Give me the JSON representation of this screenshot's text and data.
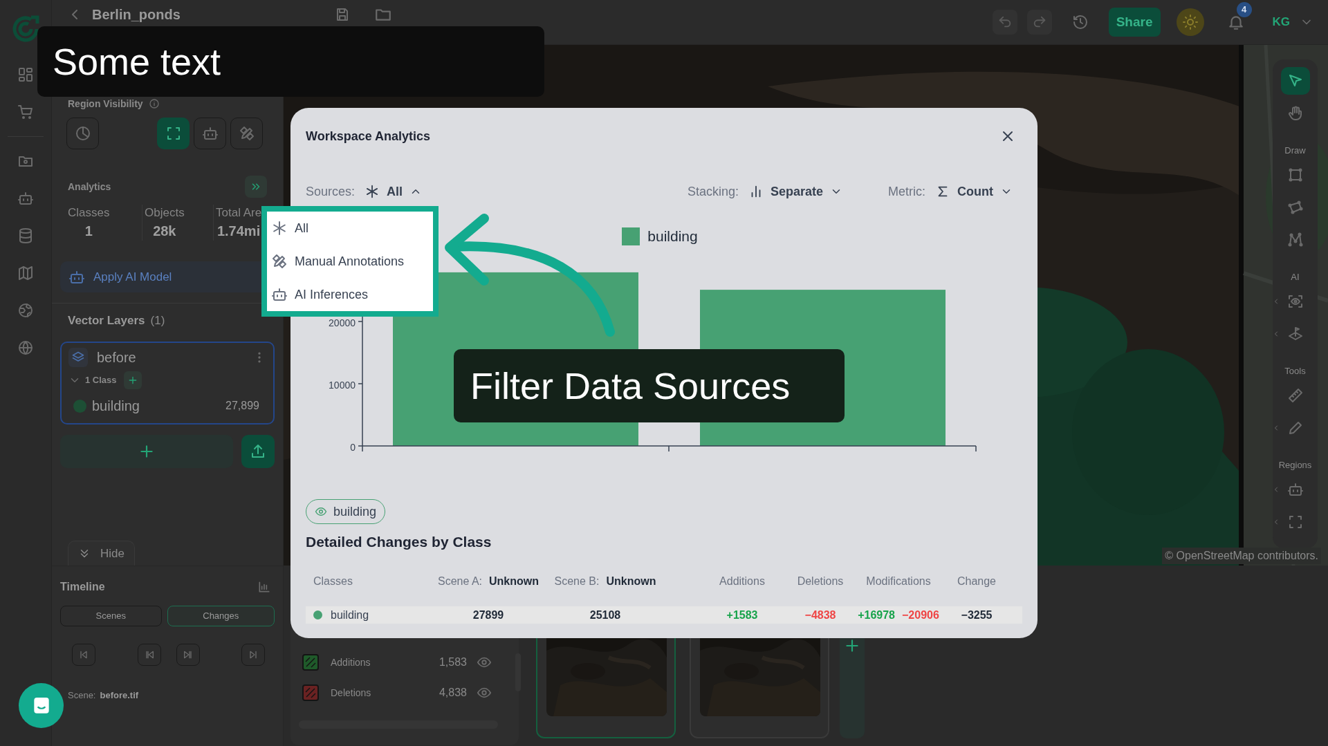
{
  "top_bar": {
    "project_title": "Berlin_ponds",
    "share_button": "Share",
    "notification_count": "4",
    "user_initials": "KG"
  },
  "caption": "Some text",
  "left_panel": {
    "region_visibility_label": "Region Visibility",
    "region_buttons": [
      {
        "selected": false
      },
      {
        "selected": true
      },
      {
        "selected": false
      },
      {
        "selected": false
      }
    ],
    "analytics_title": "Analytics",
    "stats": [
      {
        "label": "Classes",
        "value": "1"
      },
      {
        "label": "Objects",
        "value": "28k"
      },
      {
        "label": "Total Are",
        "value": "1.74mi"
      }
    ],
    "apply_ai_button": "Apply AI Model",
    "vector_layers_title": "Vector Layers",
    "vector_layers_count": "(1)",
    "layers": [
      {
        "name": "before",
        "class_count": "1 Class",
        "expanded": true,
        "classes": [
          {
            "name": "building",
            "count": "27,899",
            "color": "#1d4f35"
          }
        ]
      }
    ],
    "hide_button": "Hide"
  },
  "timeline": {
    "title": "Timeline",
    "tabs": [
      {
        "label": "Scenes",
        "selected": false
      },
      {
        "label": "Changes",
        "selected": true
      }
    ],
    "scene_label": "Scene:",
    "scene_value": "before.tif"
  },
  "change_layers": [
    {
      "label": "Additions",
      "count": "1,583",
      "color": "#1f5a2a"
    },
    {
      "label": "Deletions",
      "count": "4,838",
      "color": "#6a2222"
    }
  ],
  "thumbnails": [
    {
      "selected": true
    },
    {
      "selected": false
    }
  ],
  "map": {
    "attribution": "© OpenStreetMap contributors."
  },
  "map_tools": [
    {
      "kind": "select",
      "selected": true,
      "menu": false
    },
    {
      "kind": "pan",
      "selected": false,
      "menu": false
    },
    {
      "kind": "heading",
      "label": "Draw"
    },
    {
      "kind": "rectangle",
      "selected": false,
      "menu": false
    },
    {
      "kind": "polygon",
      "selected": false,
      "menu": false
    },
    {
      "kind": "polyline",
      "selected": false,
      "menu": false
    },
    {
      "kind": "heading",
      "label": "AI"
    },
    {
      "kind": "detect",
      "selected": false,
      "menu": true
    },
    {
      "kind": "flag",
      "selected": false,
      "menu": true
    },
    {
      "kind": "heading",
      "label": "Tools"
    },
    {
      "kind": "ruler",
      "selected": false,
      "menu": false
    },
    {
      "kind": "pencil",
      "selected": false,
      "menu": true
    },
    {
      "kind": "heading",
      "label": "Regions"
    },
    {
      "kind": "robot",
      "selected": false,
      "menu": true
    },
    {
      "kind": "frame",
      "selected": false,
      "menu": true
    }
  ],
  "modal": {
    "title": "Workspace Analytics",
    "controls": [
      {
        "kind": "sources",
        "label": "Sources:",
        "value": "All",
        "expanded": true
      },
      {
        "kind": "stacking",
        "label": "Stacking:",
        "value": "Separate",
        "expanded": false
      },
      {
        "kind": "metric",
        "label": "Metric:",
        "value": "Count",
        "expanded": false
      }
    ],
    "source_menu": [
      {
        "kind": "all",
        "label": "All"
      },
      {
        "kind": "manual",
        "label": "Manual Annotations"
      },
      {
        "kind": "ai",
        "label": "AI Inferences"
      }
    ],
    "chart_data": {
      "type": "bar",
      "series": [
        {
          "name": "building",
          "color": "#47a173",
          "values": [
            27900,
            25100
          ]
        }
      ],
      "ylim": [
        0,
        30000
      ],
      "yticks": [
        0,
        10000,
        20000
      ]
    },
    "class_chip": "building",
    "table_title": "Detailed Changes by Class",
    "table": {
      "header": {
        "classes": "Classes",
        "scene_a_label": "Scene A:",
        "scene_a_value": "Unknown",
        "scene_b_label": "Scene B:",
        "scene_b_value": "Unknown",
        "additions": "Additions",
        "deletions": "Deletions",
        "modifications": "Modifications",
        "change": "Change"
      },
      "rows": [
        {
          "class": "building",
          "color": "#47a173",
          "scene_a": "27899",
          "scene_b": "25108",
          "additions": "+1583",
          "deletions": "−4838",
          "modifications_added": "+16978",
          "modifications_removed": "−20906",
          "change": "−3255"
        }
      ]
    }
  },
  "callout": "Filter Data Sources"
}
